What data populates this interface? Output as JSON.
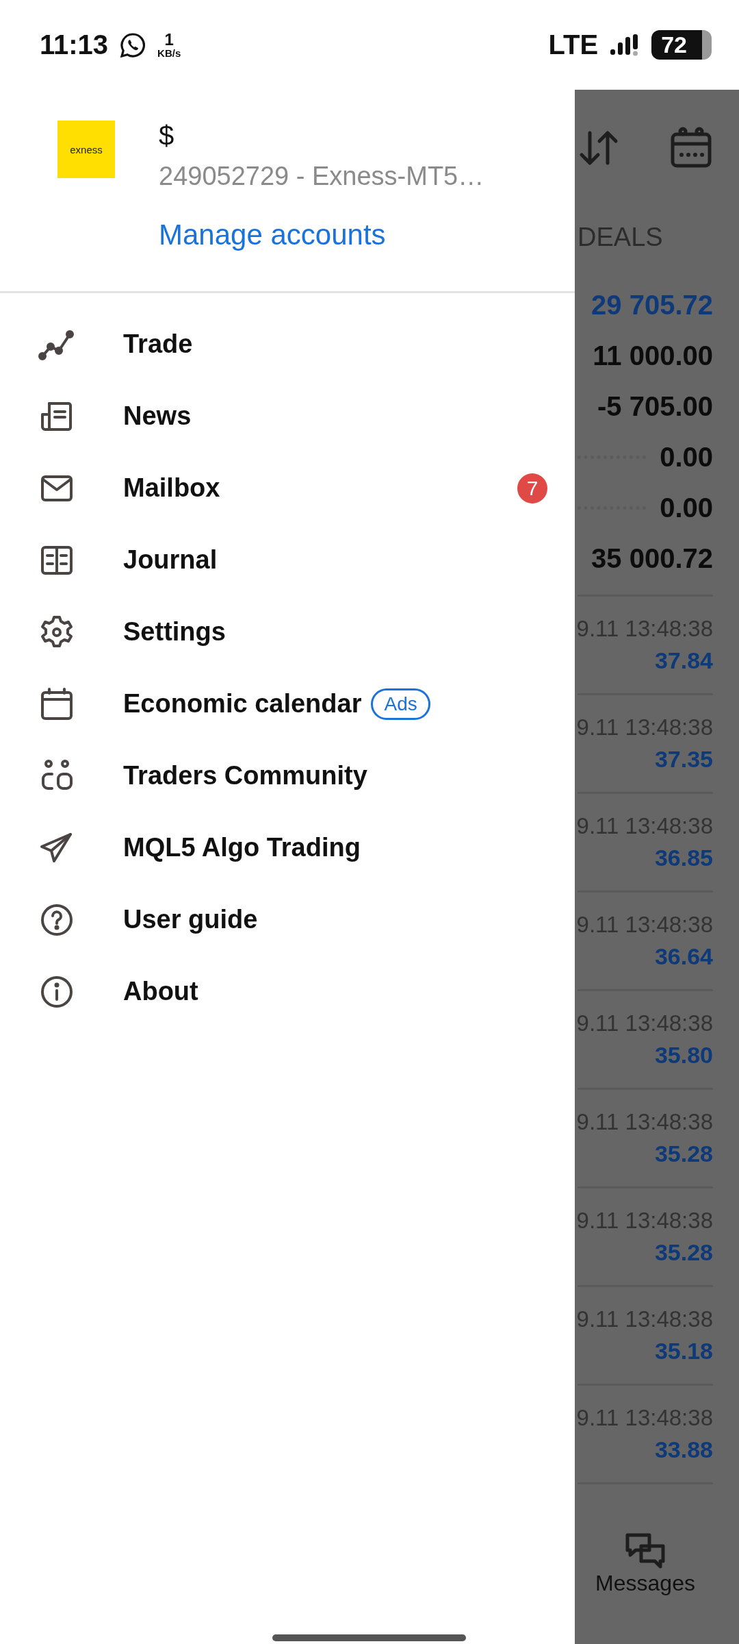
{
  "status_bar": {
    "time": "11:13",
    "speed_value": "1",
    "speed_unit": "KB/s",
    "network": "LTE",
    "battery": "72"
  },
  "drawer": {
    "account": {
      "logo_text": "exness",
      "currency": "$",
      "account_line": "249052729 - Exness-MT5…",
      "manage_link": "Manage accounts"
    },
    "menu": [
      {
        "kind": "trade",
        "label": "Trade"
      },
      {
        "kind": "news",
        "label": "News"
      },
      {
        "kind": "mailbox",
        "label": "Mailbox",
        "badge": "7"
      },
      {
        "kind": "journal",
        "label": "Journal"
      },
      {
        "kind": "settings",
        "label": "Settings"
      },
      {
        "kind": "calendar",
        "label": "Economic calendar",
        "tag": "Ads"
      },
      {
        "kind": "community",
        "label": "Traders Community"
      },
      {
        "kind": "algo",
        "label": "MQL5 Algo Trading"
      },
      {
        "kind": "guide",
        "label": "User guide"
      },
      {
        "kind": "about",
        "label": "About"
      }
    ]
  },
  "background_screen": {
    "column_label": "DEALS",
    "summary": [
      {
        "value": "29 705.72",
        "kind": "accent",
        "leader": false
      },
      {
        "value": "11 000.00",
        "kind": "plain",
        "leader": false
      },
      {
        "value": "-5 705.00",
        "kind": "plain",
        "leader": false
      },
      {
        "value": "0.00",
        "kind": "plain",
        "leader": true
      },
      {
        "value": "0.00",
        "kind": "plain",
        "leader": true
      },
      {
        "value": "35 000.72",
        "kind": "plain",
        "leader": false
      }
    ],
    "deals": [
      {
        "time": "9.11 13:48:38",
        "value": "37.84"
      },
      {
        "time": "9.11 13:48:38",
        "value": "37.35"
      },
      {
        "time": "9.11 13:48:38",
        "value": "36.85"
      },
      {
        "time": "9.11 13:48:38",
        "value": "36.64"
      },
      {
        "time": "9.11 13:48:38",
        "value": "35.80"
      },
      {
        "time": "9.11 13:48:38",
        "value": "35.28"
      },
      {
        "time": "9.11 13:48:38",
        "value": "35.28"
      },
      {
        "time": "9.11 13:48:38",
        "value": "35.18"
      },
      {
        "time": "9.11 13:48:38",
        "value": "33.88"
      }
    ],
    "bottom_tab": "Messages"
  }
}
